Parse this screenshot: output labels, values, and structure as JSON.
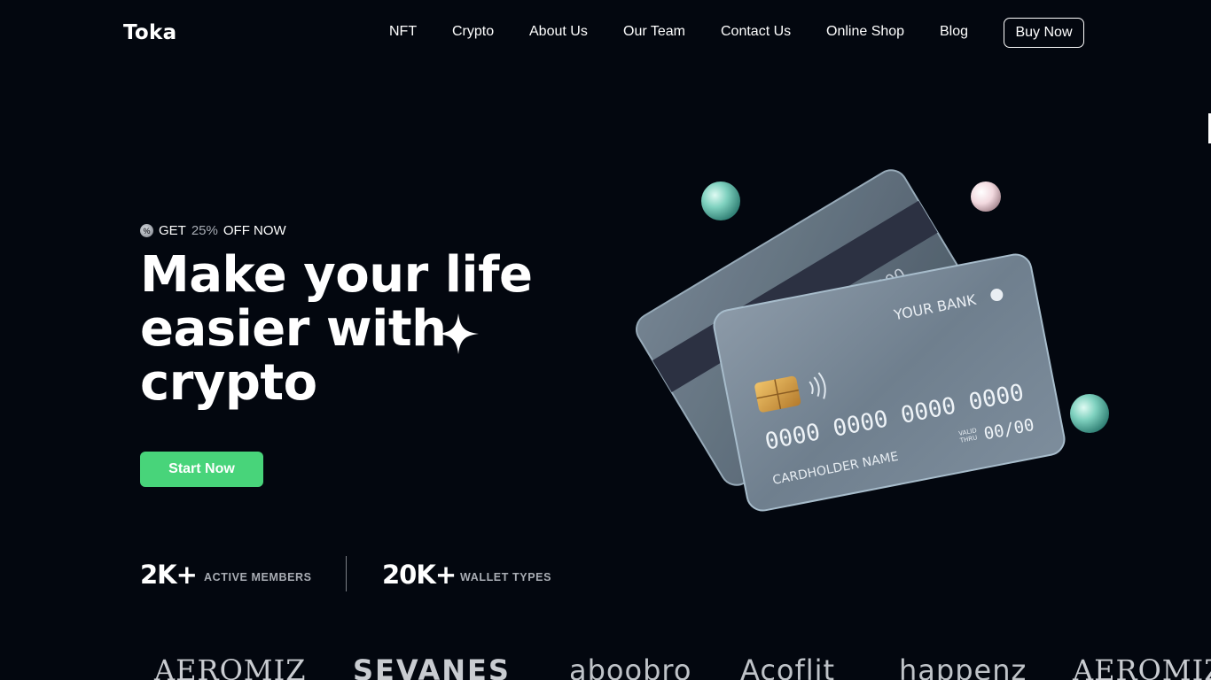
{
  "brand": {
    "name": "Toka"
  },
  "nav": {
    "items": [
      "NFT",
      "Crypto",
      "About Us",
      "Our Team",
      "Contact Us",
      "Online Shop",
      "Blog"
    ],
    "cta": "Buy Now"
  },
  "hero": {
    "promo_prefix": "GET",
    "promo_percent": "25%",
    "promo_suffix": "OFF NOW",
    "promo_icon": "percent-badge-icon",
    "headline": [
      "Make your life",
      "easier with",
      "crypto"
    ],
    "cta": "Start Now"
  },
  "stats": [
    {
      "value": "2K+",
      "label": "ACTIVE MEMBERS"
    },
    {
      "value": "20K+",
      "label": "WALLET TYPES"
    }
  ],
  "card": {
    "bank": "YOUR BANK",
    "number": [
      "0000",
      "0000",
      "0000",
      "0000"
    ],
    "valid_label_1": "VALID",
    "valid_label_2": "THRU",
    "expiry": "00/00",
    "holder": "CARDHOLDER NAME",
    "back_number_fragment": "000"
  },
  "partners": [
    "AEROMIZ",
    "SEVANES",
    "aboobro",
    "Acoflit",
    "happenz",
    "AEROMIZ"
  ],
  "colors": {
    "background": "#03070f",
    "accent": "#48d47a"
  }
}
